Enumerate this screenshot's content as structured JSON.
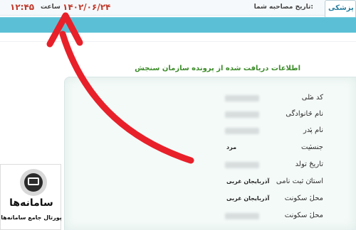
{
  "header": {
    "interview_label": "تاریخ مصاحبه شما:",
    "interview_date": "۱۴۰۲/۰۶/۲۴",
    "time_label": "ساعت",
    "interview_time": "۱۲:۴۵",
    "tab_label": "پزشکی"
  },
  "section": {
    "title": "اطلاعات دریافت شده از پرونده سازمان سنجش"
  },
  "fields": [
    {
      "label": "کد ملی",
      "value": ""
    },
    {
      "label": "نام خانوادگی",
      "value": ""
    },
    {
      "label": "نام پدر",
      "value": ""
    },
    {
      "label": "جنسیت",
      "value": "مرد"
    },
    {
      "label": "تاریخ تولد",
      "value": ""
    },
    {
      "label": "استان ثبت نامی",
      "value": "آذربایجان غربی"
    },
    {
      "label": "محل سکونت",
      "value": "آذربایجان غربی"
    },
    {
      "label": "محل سکونت",
      "value": ""
    }
  ],
  "logo": {
    "name": "سامانه‌ها",
    "tagline": "پورتال جامع سامانه‌ها"
  },
  "colors": {
    "accent_teal": "#5bc0d6",
    "date_red": "#c0392b",
    "title_green": "#3c8c2a",
    "arrow_red": "#e8202a"
  }
}
